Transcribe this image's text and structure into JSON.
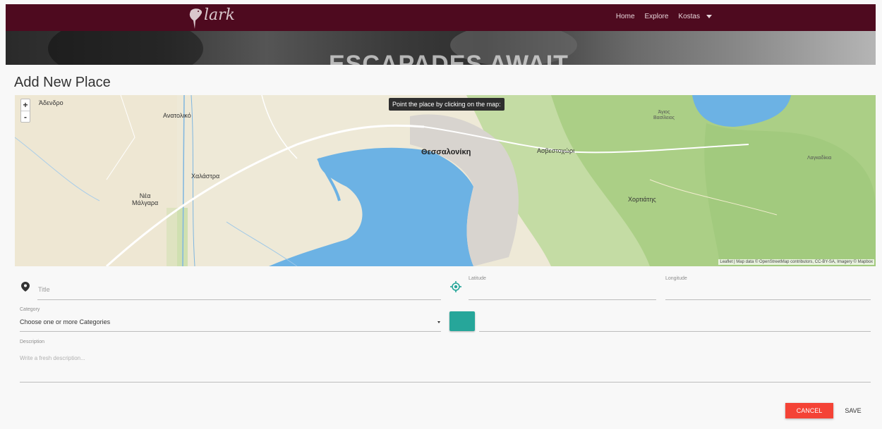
{
  "nav": {
    "logo_text": "lark",
    "links": [
      "Home",
      "Explore",
      "Kostas"
    ]
  },
  "hero": {
    "title": "ESCAPADES AWAIT"
  },
  "page": {
    "heading": "Add New Place"
  },
  "map": {
    "tooltip": "Point the place by clicking on the map:",
    "zoom_in": "+",
    "zoom_out": "-",
    "attribution": "Leaflet | Map data © OpenStreetMap contributors, CC-BY-SA, Imagery © Mapbox",
    "labels": {
      "adendro": "Άδενδρο",
      "anatoliko": "Ανατολικό",
      "chalastra": "Χαλάστρα",
      "nea_malagara": "Νέα\nΜάλγαρα",
      "thessaloniki": "Θεσσαλονίκη",
      "asvestochori": "Ασβεστοχώρι",
      "chortiatis": "Χορτιάτης",
      "agios_vasileios": "Άγιος\nΒασίλειος",
      "lagkadikia": "Λαγκαδίκια"
    },
    "colors": {
      "sea": "#6cb2e4",
      "land": "#eee9d7",
      "forest": "#b9d79a"
    }
  },
  "form": {
    "title_placeholder": "Title",
    "latitude_label": "Latitude",
    "longitude_label": "Longitude",
    "category_label": "Category",
    "category_value": "Choose one or more Categories",
    "description_label": "Description",
    "description_placeholder": "Write a fresh description...",
    "cancel_label": "CANCEL",
    "save_label": "SAVE",
    "accent_color": "#26a69a"
  }
}
